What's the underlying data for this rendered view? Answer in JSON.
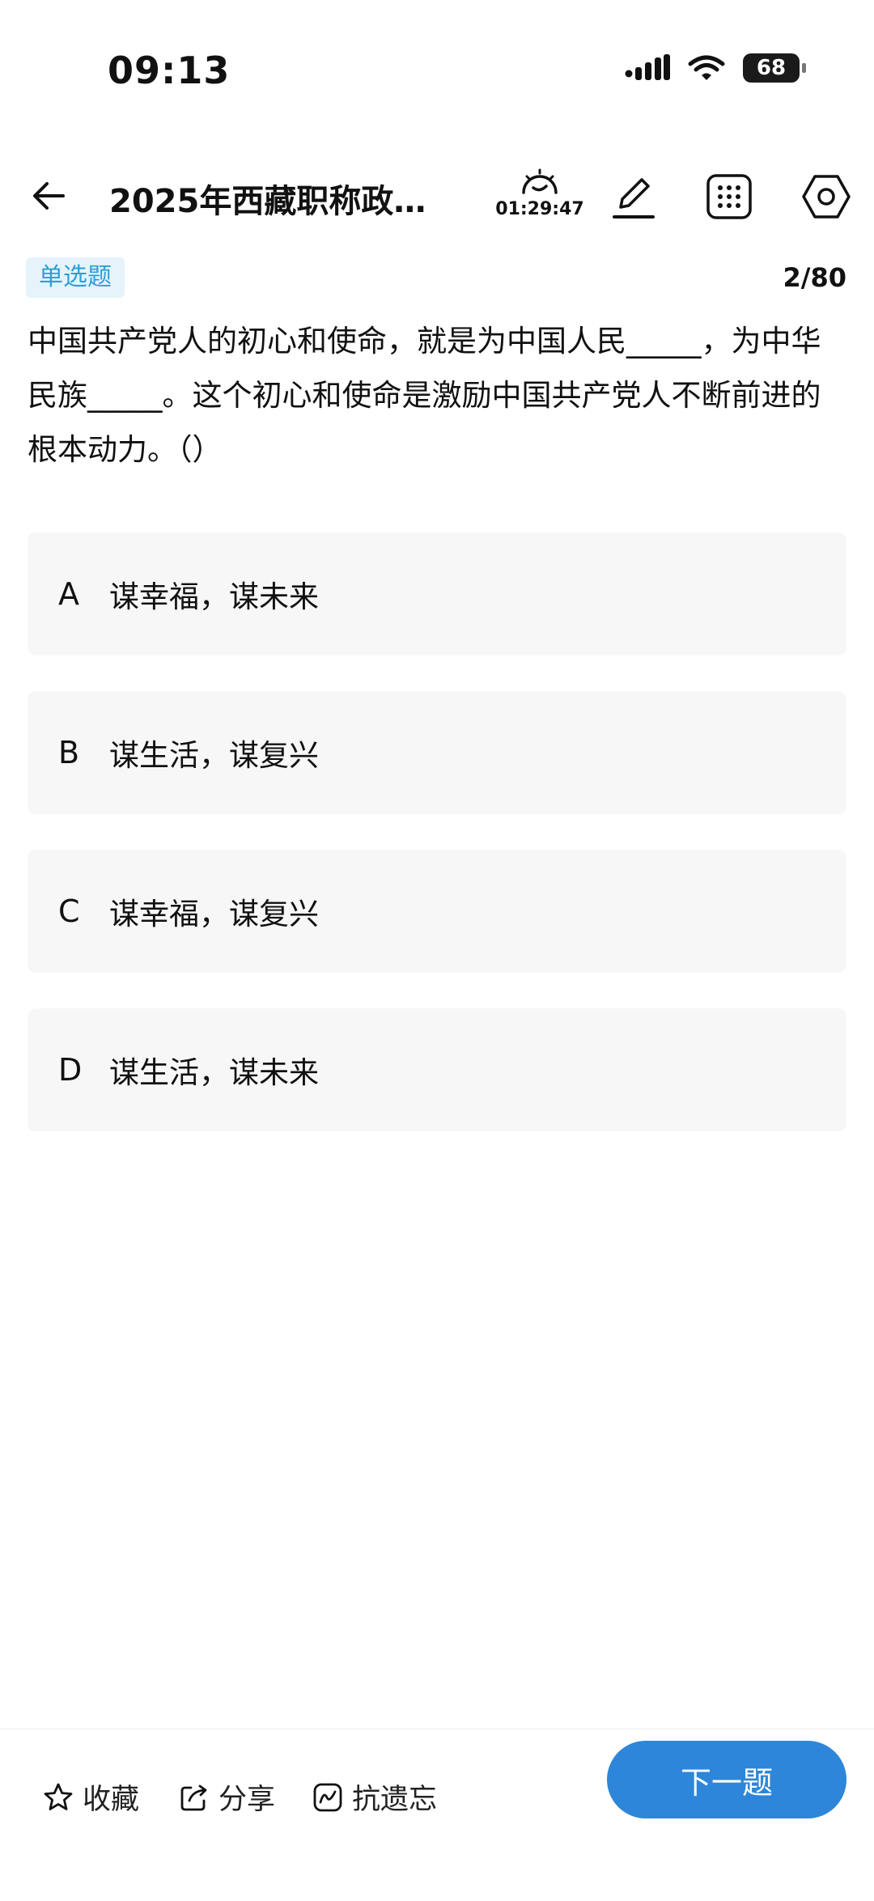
{
  "status_bar": {
    "time": "09:13",
    "battery": "68"
  },
  "header": {
    "title": "2025年西藏职称政…",
    "timer": "01:29:47",
    "icons": [
      "arrow-left-icon",
      "stopwatch-icon",
      "pen-icon",
      "grid-icon",
      "settings-icon"
    ]
  },
  "question": {
    "type_tag": "单选题",
    "progress": "2/80",
    "text": "中国共产党人的初心和使命，就是为中国人民_____，为中华民族_____。这个初心和使命是激励中国共产党人不断前进的根本动力。（）"
  },
  "options": [
    {
      "key": "A",
      "text": "谋幸福，谋未来"
    },
    {
      "key": "B",
      "text": "谋生活，谋复兴"
    },
    {
      "key": "C",
      "text": "谋幸福，谋复兴"
    },
    {
      "key": "D",
      "text": "谋生活，谋未来"
    }
  ],
  "bottom_bar": {
    "favorite": "收藏",
    "share": "分享",
    "anti_forget": "抗遗忘",
    "next": "下一题"
  },
  "colors": {
    "accent": "#2d86d9",
    "tag_text": "#2a9fd8",
    "tag_bg": "#e6f3fb",
    "option_bg": "#f7f7f7"
  }
}
